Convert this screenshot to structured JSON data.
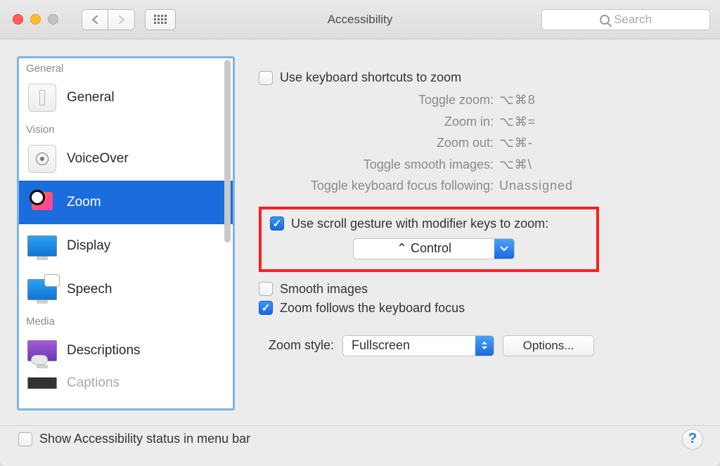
{
  "window": {
    "title": "Accessibility",
    "search_placeholder": "Search"
  },
  "sidebar": {
    "sections": [
      {
        "label": "General",
        "items": [
          {
            "label": "General"
          }
        ]
      },
      {
        "label": "Vision",
        "items": [
          {
            "label": "VoiceOver"
          },
          {
            "label": "Zoom",
            "selected": true
          },
          {
            "label": "Display"
          },
          {
            "label": "Speech"
          }
        ]
      },
      {
        "label": "Media",
        "items": [
          {
            "label": "Descriptions"
          },
          {
            "label": "Captions"
          }
        ]
      }
    ]
  },
  "pane": {
    "use_keyboard_shortcuts_label": "Use keyboard shortcuts to zoom",
    "use_keyboard_shortcuts_checked": false,
    "shortcuts": [
      {
        "label": "Toggle zoom:",
        "value": "⌥⌘8"
      },
      {
        "label": "Zoom in:",
        "value": "⌥⌘="
      },
      {
        "label": "Zoom out:",
        "value": "⌥⌘-"
      },
      {
        "label": "Toggle smooth images:",
        "value": "⌥⌘\\"
      },
      {
        "label": "Toggle keyboard focus following:",
        "value": "Unassigned"
      }
    ],
    "scroll_gesture_label": "Use scroll gesture with modifier keys to zoom:",
    "scroll_gesture_checked": true,
    "modifier_selected": "⌃ Control",
    "smooth_images_label": "Smooth images",
    "smooth_images_checked": false,
    "zoom_follows_label": "Zoom follows the keyboard focus",
    "zoom_follows_checked": true,
    "zoom_style_label": "Zoom style:",
    "zoom_style_value": "Fullscreen",
    "options_label": "Options..."
  },
  "footer": {
    "status_label": "Show Accessibility status in menu bar",
    "status_checked": false,
    "help_label": "?"
  }
}
